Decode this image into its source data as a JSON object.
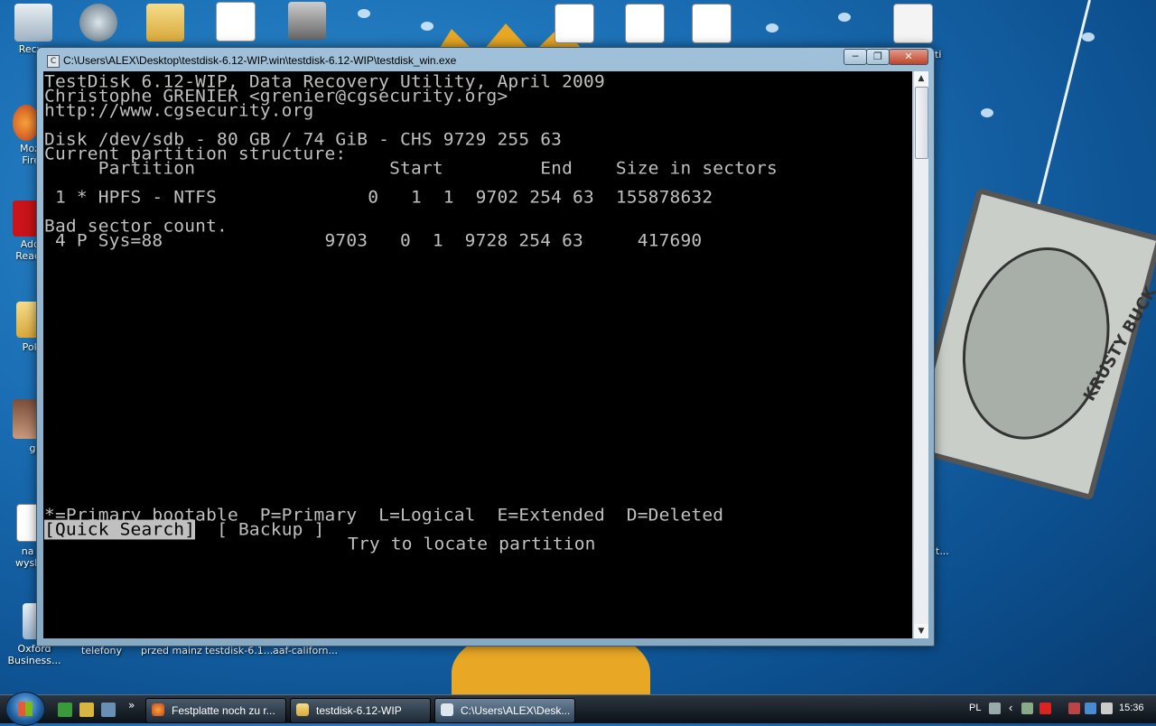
{
  "desktop": {
    "icons": [
      {
        "label": "Recyc",
        "id": "recycle"
      },
      {
        "label": "Moz\nFire",
        "id": "firefox"
      },
      {
        "label": "Add\nReac",
        "id": "acrobat"
      },
      {
        "label": "Pok",
        "id": "folder-pok"
      },
      {
        "label": "gr",
        "id": "photo"
      },
      {
        "label": "na g\nwysla",
        "id": "word-doc"
      },
      {
        "label": "Oxford\nBusiness...",
        "id": "oxford"
      },
      {
        "label": "telefony",
        "id": "telefony"
      },
      {
        "label": "przed mainz",
        "id": "przed-mainz"
      },
      {
        "label": "testdisk-6.1...",
        "id": "testdisk"
      },
      {
        "label": "aaf-californ...",
        "id": "aaf-california"
      },
      {
        "label": "ti",
        "id": "text-file"
      },
      {
        "label": "t...",
        "id": "right-file"
      }
    ],
    "wallpaper_text": "KRUSTY BUCK"
  },
  "window": {
    "title": "C:\\Users\\ALEX\\Desktop\\testdisk-6.12-WIP.win\\testdisk-6.12-WIP\\testdisk_win.exe",
    "min_label": "─",
    "max_label": "❐",
    "close_label": "✕"
  },
  "console": {
    "header1": "TestDisk 6.12-WIP, Data Recovery Utility, April 2009",
    "header2": "Christophe GRENIER <grenier@cgsecurity.org>",
    "header3": "http://www.cgsecurity.org",
    "disk_line": "Disk /dev/sdb - 80 GB / 74 GiB - CHS 9729 255 63",
    "structure_title": "Current partition structure:",
    "col_header": "     Partition                  Start         End    Size in sectors",
    "row1": " 1 * HPFS - NTFS              0   1  1  9702 254 63  155878632",
    "bad_sector": "Bad sector count.",
    "row2": " 4 P Sys=88               9703   0  1  9728 254 63     417690",
    "legend": "*=Primary bootable  P=Primary  L=Logical  E=Extended  D=Deleted",
    "menu_quick": "[Quick Search]",
    "menu_backup": "[ Backup ]",
    "hint": "Try to locate partition"
  },
  "taskbar": {
    "buttons": [
      {
        "label": "Festplatte noch zu r...",
        "id": "firefox-task"
      },
      {
        "label": "testdisk-6.12-WIP",
        "id": "folder-task"
      },
      {
        "label": "C:\\Users\\ALEX\\Desk...",
        "id": "console-task"
      }
    ],
    "language": "PL",
    "clock": "15:36"
  },
  "colors": {
    "console_bg": "#000000",
    "console_text": "#c0c0c0",
    "highlight_bg": "#c0c0c0"
  }
}
